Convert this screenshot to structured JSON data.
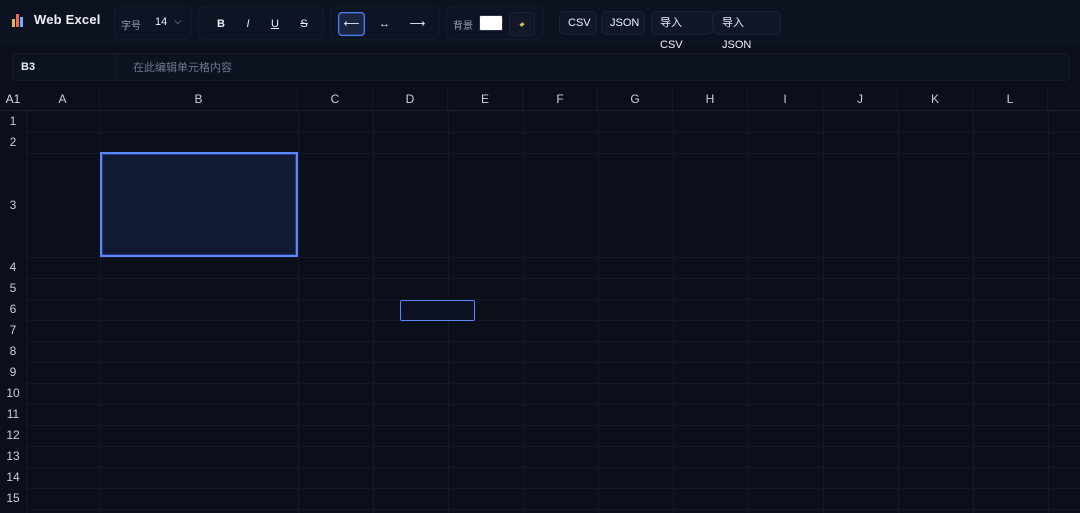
{
  "app": {
    "title": "Web Excel"
  },
  "toolbar": {
    "font_size_label": "字号",
    "font_size_value": "14",
    "bold": "B",
    "italic": "I",
    "underline": "U",
    "strike": "S",
    "align_left": "⟵",
    "align_center": "↔",
    "align_right": "⟶",
    "bg_label": "背景",
    "bg_color": "#ffffff",
    "csv": "CSV",
    "json": "JSON",
    "import_csv": "导入CSV",
    "import_json": "导入JSON"
  },
  "formula": {
    "cell_ref": "B3",
    "value": "",
    "placeholder": "在此编辑单元格内容"
  },
  "grid": {
    "corner": "A1",
    "columns": [
      "A",
      "B",
      "C",
      "D",
      "E",
      "F",
      "G",
      "H",
      "I",
      "J",
      "K",
      "L"
    ],
    "rows": [
      "1",
      "2",
      "3",
      "4",
      "5",
      "6",
      "7",
      "8",
      "9",
      "10",
      "11",
      "12",
      "13",
      "14",
      "15"
    ],
    "selected_cell": "B3",
    "editing_cell": "D6"
  },
  "colors": {
    "accent": "#5b86ff",
    "background": "#0b0f1a"
  }
}
